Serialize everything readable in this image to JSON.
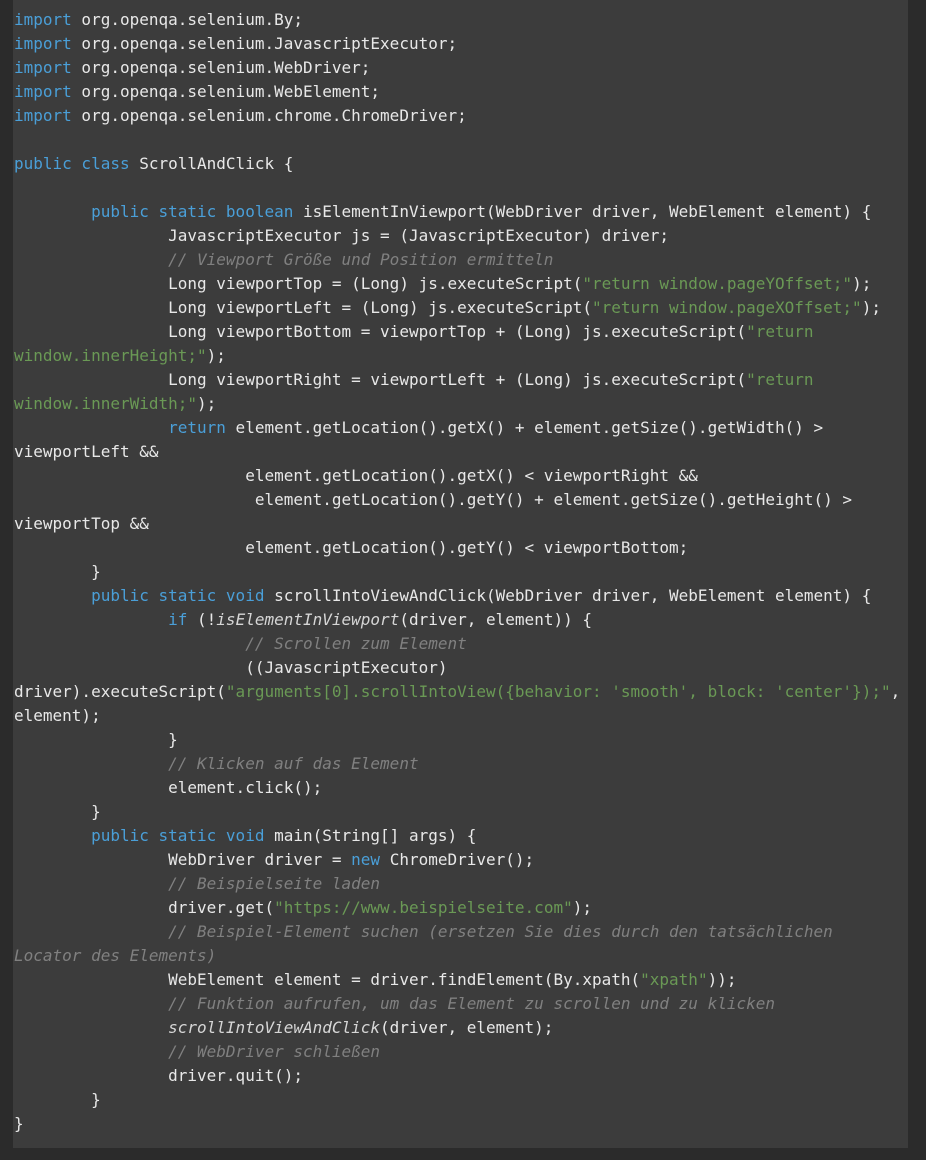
{
  "document": {
    "kind": "code-listing",
    "language": "Java",
    "class_name": "ScrollAndClick",
    "theme": {
      "background": "#3c3c3c",
      "page_background": "#2b2b2b",
      "default_text": "#e8e8e8",
      "keyword": "#4a9fd8",
      "string": "#6a9955",
      "comment": "#808080"
    },
    "lines": [
      {
        "id": "l1",
        "tokens": [
          {
            "t": "kw",
            "v": "import"
          },
          {
            "t": "pln",
            "v": " org.openqa.selenium.By;"
          }
        ]
      },
      {
        "id": "l2",
        "tokens": [
          {
            "t": "kw",
            "v": "import"
          },
          {
            "t": "pln",
            "v": " org.openqa.selenium.JavascriptExecutor;"
          }
        ]
      },
      {
        "id": "l3",
        "tokens": [
          {
            "t": "kw",
            "v": "import"
          },
          {
            "t": "pln",
            "v": " org.openqa.selenium.WebDriver;"
          }
        ]
      },
      {
        "id": "l4",
        "tokens": [
          {
            "t": "kw",
            "v": "import"
          },
          {
            "t": "pln",
            "v": " org.openqa.selenium.WebElement;"
          }
        ]
      },
      {
        "id": "l5",
        "tokens": [
          {
            "t": "kw",
            "v": "import"
          },
          {
            "t": "pln",
            "v": " org.openqa.selenium.chrome.ChromeDriver;"
          }
        ]
      },
      {
        "id": "l6",
        "tokens": []
      },
      {
        "id": "l7",
        "tokens": [
          {
            "t": "kw",
            "v": "public class"
          },
          {
            "t": "pln",
            "v": " ScrollAndClick {"
          }
        ]
      },
      {
        "id": "l8",
        "tokens": []
      },
      {
        "id": "l9",
        "tokens": [
          {
            "t": "pln",
            "v": "        "
          },
          {
            "t": "kw",
            "v": "public static boolean"
          },
          {
            "t": "pln",
            "v": " isElementInViewport(WebDriver driver, WebElement element) {"
          }
        ]
      },
      {
        "id": "l10",
        "tokens": [
          {
            "t": "pln",
            "v": "                JavascriptExecutor js = (JavascriptExecutor) driver;"
          }
        ]
      },
      {
        "id": "l11",
        "tokens": [
          {
            "t": "pln",
            "v": "                "
          },
          {
            "t": "cmt",
            "v": "// Viewport Größe und Position ermitteln"
          }
        ]
      },
      {
        "id": "l12",
        "tokens": [
          {
            "t": "pln",
            "v": "                Long viewportTop = (Long) js.executeScript("
          },
          {
            "t": "str",
            "v": "\"return window.pageYOffset;\""
          },
          {
            "t": "pln",
            "v": ");"
          }
        ]
      },
      {
        "id": "l13",
        "tokens": [
          {
            "t": "pln",
            "v": "                Long viewportLeft = (Long) js.executeScript("
          },
          {
            "t": "str",
            "v": "\"return window.pageXOffset;\""
          },
          {
            "t": "pln",
            "v": ");"
          }
        ]
      },
      {
        "id": "l14",
        "tokens": [
          {
            "t": "pln",
            "v": "                Long viewportBottom = viewportTop + (Long) js.executeScript("
          },
          {
            "t": "str",
            "v": "\"return window.innerHeight;\""
          },
          {
            "t": "pln",
            "v": ");"
          }
        ]
      },
      {
        "id": "l15",
        "tokens": [
          {
            "t": "pln",
            "v": "                Long viewportRight = viewportLeft + (Long) js.executeScript("
          },
          {
            "t": "str",
            "v": "\"return window.innerWidth;\""
          },
          {
            "t": "pln",
            "v": ");"
          }
        ]
      },
      {
        "id": "l16",
        "tokens": [
          {
            "t": "pln",
            "v": "                "
          },
          {
            "t": "kw",
            "v": "return"
          },
          {
            "t": "pln",
            "v": " element.getLocation().getX() + element.getSize().getWidth() > viewportLeft &&"
          }
        ]
      },
      {
        "id": "l17",
        "tokens": [
          {
            "t": "pln",
            "v": "                        element.getLocation().getX() < viewportRight &&"
          }
        ]
      },
      {
        "id": "l18",
        "tokens": [
          {
            "t": "pln",
            "v": "                         element.getLocation().getY() + element.getSize().getHeight() > viewportTop &&"
          }
        ]
      },
      {
        "id": "l19",
        "tokens": [
          {
            "t": "pln",
            "v": "                        element.getLocation().getY() < viewportBottom;"
          }
        ]
      },
      {
        "id": "l20",
        "tokens": [
          {
            "t": "pln",
            "v": "        }"
          }
        ]
      },
      {
        "id": "l21",
        "tokens": [
          {
            "t": "pln",
            "v": "        "
          },
          {
            "t": "kw",
            "v": "public static void"
          },
          {
            "t": "pln",
            "v": " scrollIntoViewAndClick(WebDriver driver, WebElement element) {"
          }
        ]
      },
      {
        "id": "l22",
        "tokens": [
          {
            "t": "pln",
            "v": "                "
          },
          {
            "t": "kw",
            "v": "if"
          },
          {
            "t": "pln",
            "v": " (!"
          },
          {
            "t": "ital",
            "v": "isElementInViewport"
          },
          {
            "t": "pln",
            "v": "(driver, element)) {"
          }
        ]
      },
      {
        "id": "l23",
        "tokens": [
          {
            "t": "pln",
            "v": "                        "
          },
          {
            "t": "cmt",
            "v": "// Scrollen zum Element"
          }
        ]
      },
      {
        "id": "l24",
        "tokens": [
          {
            "t": "pln",
            "v": "                        ((JavascriptExecutor) driver).executeScript("
          },
          {
            "t": "str",
            "v": "\"arguments[0].scrollIntoView({behavior: 'smooth', block: 'center'});\""
          },
          {
            "t": "pln",
            "v": ", element);"
          }
        ]
      },
      {
        "id": "l25",
        "tokens": [
          {
            "t": "pln",
            "v": "                }"
          }
        ]
      },
      {
        "id": "l26",
        "tokens": [
          {
            "t": "pln",
            "v": "                "
          },
          {
            "t": "cmt",
            "v": "// Klicken auf das Element"
          }
        ]
      },
      {
        "id": "l27",
        "tokens": [
          {
            "t": "pln",
            "v": "                element.click();"
          }
        ]
      },
      {
        "id": "l28",
        "tokens": [
          {
            "t": "pln",
            "v": "        }"
          }
        ]
      },
      {
        "id": "l29",
        "tokens": [
          {
            "t": "pln",
            "v": "        "
          },
          {
            "t": "kw",
            "v": "public static void"
          },
          {
            "t": "pln",
            "v": " main(String[] args) {"
          }
        ]
      },
      {
        "id": "l30",
        "tokens": [
          {
            "t": "pln",
            "v": "                WebDriver driver = "
          },
          {
            "t": "kw",
            "v": "new"
          },
          {
            "t": "pln",
            "v": " ChromeDriver();"
          }
        ]
      },
      {
        "id": "l31",
        "tokens": [
          {
            "t": "pln",
            "v": "                "
          },
          {
            "t": "cmt",
            "v": "// Beispielseite laden"
          }
        ]
      },
      {
        "id": "l32",
        "tokens": [
          {
            "t": "pln",
            "v": "                driver.get("
          },
          {
            "t": "str",
            "v": "\"https://www.beispielseite.com\""
          },
          {
            "t": "pln",
            "v": ");"
          }
        ]
      },
      {
        "id": "l33",
        "tokens": [
          {
            "t": "pln",
            "v": "                "
          },
          {
            "t": "cmt",
            "v": "// Beispiel-Element suchen (ersetzen Sie dies durch den tatsächlichen Locator des Elements)"
          }
        ]
      },
      {
        "id": "l34",
        "tokens": [
          {
            "t": "pln",
            "v": "                WebElement element = driver.findElement(By.xpath("
          },
          {
            "t": "str",
            "v": "\"xpath\""
          },
          {
            "t": "pln",
            "v": "));"
          }
        ]
      },
      {
        "id": "l35",
        "tokens": [
          {
            "t": "pln",
            "v": "                "
          },
          {
            "t": "cmt",
            "v": "// Funktion aufrufen, um das Element zu scrollen und zu klicken"
          }
        ]
      },
      {
        "id": "l36",
        "tokens": [
          {
            "t": "pln",
            "v": "                "
          },
          {
            "t": "ital",
            "v": "scrollIntoViewAndClick"
          },
          {
            "t": "pln",
            "v": "(driver, element);"
          }
        ]
      },
      {
        "id": "l37",
        "tokens": [
          {
            "t": "pln",
            "v": "                "
          },
          {
            "t": "cmt",
            "v": "// WebDriver schließen"
          }
        ]
      },
      {
        "id": "l38",
        "tokens": [
          {
            "t": "pln",
            "v": "                driver.quit();"
          }
        ]
      },
      {
        "id": "l39",
        "tokens": [
          {
            "t": "pln",
            "v": "        }"
          }
        ]
      },
      {
        "id": "l40",
        "tokens": [
          {
            "t": "pln",
            "v": "}"
          }
        ]
      }
    ]
  }
}
